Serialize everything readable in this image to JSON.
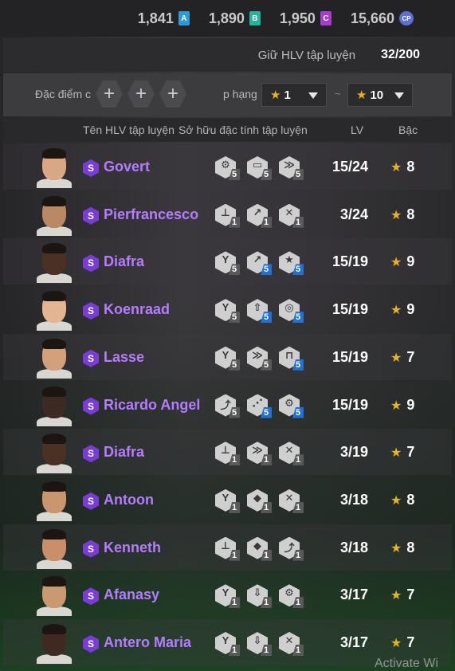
{
  "currency": [
    {
      "value": "1,841",
      "badge": "A",
      "color": "#2e9bd6"
    },
    {
      "value": "1,890",
      "badge": "B",
      "color": "#22b59a"
    },
    {
      "value": "1,950",
      "badge": "C",
      "color": "#a63ad1"
    },
    {
      "value": "15,660",
      "badge": "CP",
      "color": "#5a6fd8"
    }
  ],
  "holding": {
    "label": "Giữ HLV tập luyện",
    "value": "32/200"
  },
  "filters": {
    "trait_label": "Đặc điểm c",
    "rank_label": "p hạng",
    "rank_from": "1",
    "rank_to": "10",
    "separator": "~"
  },
  "columns": {
    "name": "Tên HLV tập luyện",
    "traits": "Sở hữu đặc tính tập luyện",
    "lv": "LV",
    "grade": "Bậc"
  },
  "rows": [
    {
      "name": "Govert",
      "lv": "15/24",
      "grade": "8",
      "skin": "#d9a883",
      "traits": [
        {
          "icon": "fitness-icon",
          "glyph": "⚙",
          "level": "5",
          "tier": "gray"
        },
        {
          "icon": "shield-icon",
          "glyph": "▭",
          "level": "5",
          "tier": "gray"
        },
        {
          "icon": "tackle-icon",
          "glyph": "≫",
          "level": "5",
          "tier": "gray"
        }
      ]
    },
    {
      "name": "Pierfrancesco",
      "lv": "3/24",
      "grade": "8",
      "skin": "#b88963",
      "traits": [
        {
          "icon": "crossbar-icon",
          "glyph": "⊥",
          "level": "1",
          "tier": "gray"
        },
        {
          "icon": "sprint-icon",
          "glyph": "↗",
          "level": "1",
          "tier": "gray"
        },
        {
          "icon": "header-icon",
          "glyph": "✕",
          "level": "1",
          "tier": "gray"
        }
      ]
    },
    {
      "name": "Diafra",
      "lv": "15/19",
      "grade": "9",
      "skin": "#4b3024",
      "traits": [
        {
          "icon": "strength-icon",
          "glyph": "Y",
          "level": "5",
          "tier": "gray"
        },
        {
          "icon": "shot-icon",
          "glyph": "↗",
          "level": "5",
          "tier": "blue"
        },
        {
          "icon": "skill-icon",
          "glyph": "★",
          "level": "5",
          "tier": "blue"
        }
      ]
    },
    {
      "name": "Koenraad",
      "lv": "15/19",
      "grade": "9",
      "skin": "#e3b592",
      "traits": [
        {
          "icon": "strength-icon",
          "glyph": "Y",
          "level": "5",
          "tier": "gray"
        },
        {
          "icon": "boost-icon",
          "glyph": "⇧",
          "level": "5",
          "tier": "blue"
        },
        {
          "icon": "focus-icon",
          "glyph": "◎",
          "level": "5",
          "tier": "blue"
        }
      ]
    },
    {
      "name": "Lasse",
      "lv": "15/19",
      "grade": "7",
      "skin": "#d2a07a",
      "traits": [
        {
          "icon": "strength-icon",
          "glyph": "Y",
          "level": "5",
          "tier": "gray"
        },
        {
          "icon": "dribble-icon",
          "glyph": "≫",
          "level": "5",
          "tier": "gray"
        },
        {
          "icon": "guard-icon",
          "glyph": "⊓",
          "level": "5",
          "tier": "blue"
        }
      ]
    },
    {
      "name": "Ricardo Angel",
      "lv": "15/19",
      "grade": "9",
      "skin": "#3d2a22",
      "traits": [
        {
          "icon": "run-icon",
          "glyph": "⤴",
          "level": "5",
          "tier": "gray"
        },
        {
          "icon": "pass-icon",
          "glyph": "⋰",
          "level": "5",
          "tier": "blue"
        },
        {
          "icon": "gear-icon",
          "glyph": "⚙",
          "level": "5",
          "tier": "blue"
        }
      ]
    },
    {
      "name": "Diafra",
      "lv": "3/19",
      "grade": "7",
      "skin": "#4b3024",
      "traits": [
        {
          "icon": "crossbar-icon",
          "glyph": "⊥",
          "level": "1",
          "tier": "gray"
        },
        {
          "icon": "tackle-icon",
          "glyph": "≫",
          "level": "1",
          "tier": "gray"
        },
        {
          "icon": "header-icon",
          "glyph": "✕",
          "level": "1",
          "tier": "gray"
        }
      ]
    },
    {
      "name": "Antoon",
      "lv": "3/18",
      "grade": "8",
      "skin": "#c9966f",
      "traits": [
        {
          "icon": "strength-icon",
          "glyph": "Y",
          "level": "1",
          "tier": "gray"
        },
        {
          "icon": "keeper-icon",
          "glyph": "◆",
          "level": "1",
          "tier": "gray"
        },
        {
          "icon": "kick-icon",
          "glyph": "✕",
          "level": "1",
          "tier": "gray"
        }
      ]
    },
    {
      "name": "Kenneth",
      "lv": "3/18",
      "grade": "8",
      "skin": "#c88f68",
      "traits": [
        {
          "icon": "crossbar-icon",
          "glyph": "⊥",
          "level": "1",
          "tier": "gray"
        },
        {
          "icon": "keeper-icon",
          "glyph": "◆",
          "level": "1",
          "tier": "gray"
        },
        {
          "icon": "run-icon",
          "glyph": "⤴",
          "level": "1",
          "tier": "gray"
        }
      ]
    },
    {
      "name": "Afanasy",
      "lv": "3/17",
      "grade": "7",
      "skin": "#c99a72",
      "traits": [
        {
          "icon": "strength-icon",
          "glyph": "Y",
          "level": "1",
          "tier": "gray"
        },
        {
          "icon": "tie-icon",
          "glyph": "⇩",
          "level": "1",
          "tier": "gray"
        },
        {
          "icon": "gear-icon",
          "glyph": "⚙",
          "level": "1",
          "tier": "gray"
        }
      ]
    },
    {
      "name": "Antero Maria",
      "lv": "3/17",
      "grade": "7",
      "skin": "#3f2a21",
      "traits": [
        {
          "icon": "strength-icon",
          "glyph": "Y",
          "level": "1",
          "tier": "gray"
        },
        {
          "icon": "tie-icon",
          "glyph": "⇩",
          "level": "1",
          "tier": "gray"
        },
        {
          "icon": "header-icon",
          "glyph": "✕",
          "level": "1",
          "tier": "gray"
        }
      ]
    }
  ],
  "watermark": "Activate Wi"
}
